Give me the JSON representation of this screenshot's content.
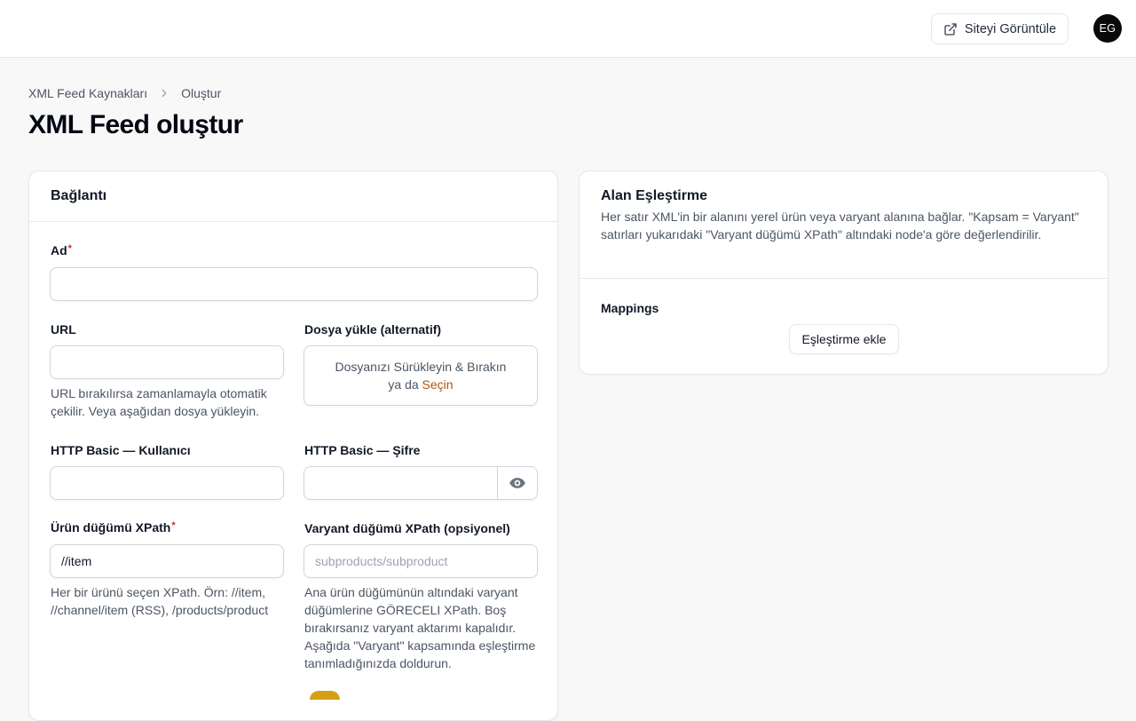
{
  "header": {
    "view_site_label": "Siteyi Görüntüle",
    "avatar_initials": "EG"
  },
  "breadcrumb": {
    "items": [
      "XML Feed Kaynakları",
      "Oluştur"
    ]
  },
  "page": {
    "title": "XML Feed oluştur"
  },
  "connection": {
    "title": "Bağlantı",
    "name_label": "Ad",
    "name_value": "",
    "url_label": "URL",
    "url_value": "",
    "url_help": "URL bırakılırsa zamanlamayla otomatik çekilir. Veya aşağıdan dosya yükleyin.",
    "file_label": "Dosya yükle (alternatif)",
    "dropzone_text": "Dosyanızı Sürükleyin & Bırakın",
    "dropzone_or": "ya da",
    "dropzone_pick": "Seçin",
    "user_label": "HTTP Basic — Kullanıcı",
    "user_value": "",
    "password_label": "HTTP Basic — Şifre",
    "password_value": "",
    "product_xpath_label": "Ürün düğümü XPath",
    "product_xpath_value": "//item",
    "product_xpath_help": "Her bir ürünü seçen XPath. Örn: //item, //channel/item (RSS), /products/product",
    "variant_xpath_label": "Varyant düğümü XPath (opsiyonel)",
    "variant_xpath_placeholder": "subproducts/subproduct",
    "variant_xpath_help": "Ana ürün düğümünün altındaki varyant düğümlerine GÖRECELI XPath. Boş bırakırsanız varyant aktarımı kapalıdır. Aşağıda \"Varyant\" kapsamında eşleştirme tanımladığınızda doldurun."
  },
  "mapping": {
    "title": "Alan Eşleştirme",
    "description": "Her satır XML'in bir alanını yerel ürün veya varyant alanına bağlar. \"Kapsam = Varyant\" satırları yukarıdaki \"Varyant düğümü XPath\" altındaki node'a göre değerlendirilir.",
    "mappings_label": "Mappings",
    "add_button_label": "Eşleştirme ekle"
  },
  "colors": {
    "accent": "#b45309",
    "required": "#dc2626",
    "toggle": "#d4a017"
  }
}
